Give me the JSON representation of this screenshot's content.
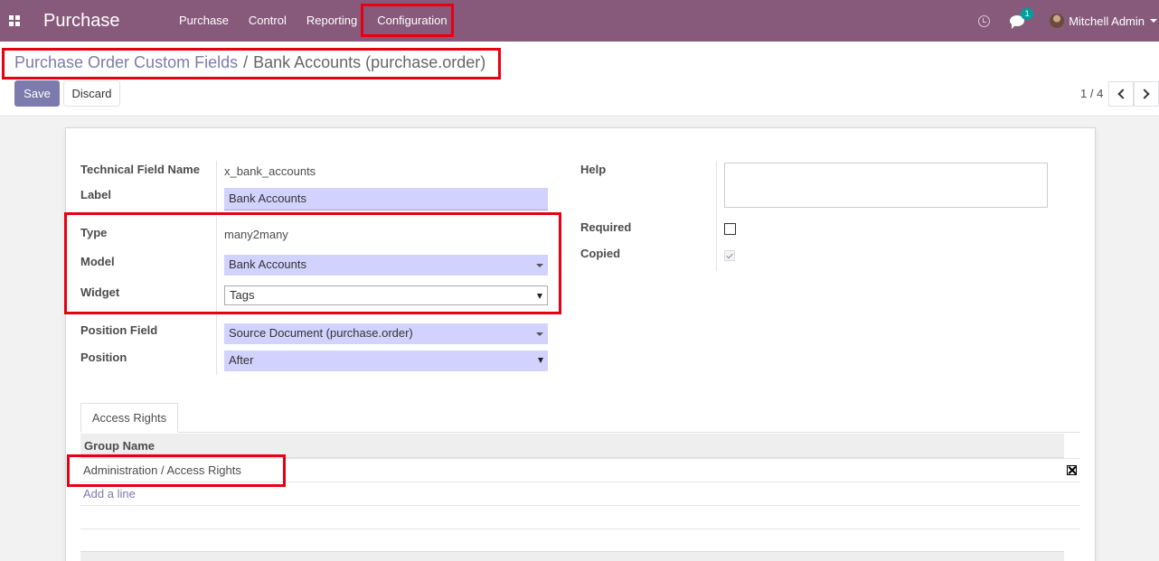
{
  "navbar": {
    "app_name": "Purchase",
    "menu": [
      "Purchase",
      "Control",
      "Reporting",
      "Configuration"
    ],
    "chat_badge": "1",
    "user_name": "Mitchell Admin",
    "brand_color": "#875a7b"
  },
  "breadcrumb": {
    "parent": "Purchase Order Custom Fields",
    "separator": "/",
    "current": "Bank Accounts (purchase.order)"
  },
  "toolbar": {
    "save_label": "Save",
    "discard_label": "Discard",
    "pager": "1 / 4"
  },
  "form": {
    "technical_name_label": "Technical Field Name",
    "technical_name_value": "x_bank_accounts",
    "label_label": "Label",
    "label_value": "Bank Accounts",
    "type_label": "Type",
    "type_value": "many2many",
    "model_label": "Model",
    "model_value": "Bank Accounts",
    "widget_label": "Widget",
    "widget_value": "Tags",
    "position_field_label": "Position Field",
    "position_field_value": "Source Document (purchase.order)",
    "position_label": "Position",
    "position_value": "After",
    "help_label": "Help",
    "help_value": "",
    "required_label": "Required",
    "required_checked": false,
    "copied_label": "Copied",
    "copied_checked": true
  },
  "notebook": {
    "tab_label": "Access Rights",
    "column_header": "Group Name",
    "rows": [
      "Administration / Access Rights"
    ],
    "add_line": "Add a line"
  },
  "accent_color": "#7c7bad",
  "highlight_color": "#e60012"
}
